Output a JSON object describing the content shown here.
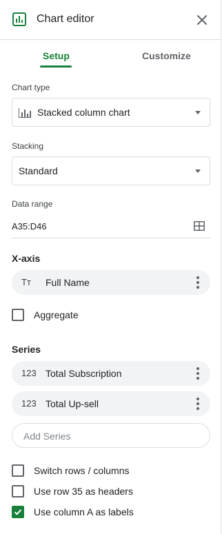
{
  "header": {
    "title": "Chart editor",
    "app_icon": "chart-icon",
    "close_icon": "close-icon"
  },
  "tabs": [
    {
      "label": "Setup",
      "active": true
    },
    {
      "label": "Customize",
      "active": false
    }
  ],
  "chart_type": {
    "label": "Chart type",
    "value": "Stacked column chart",
    "icon": "stacked-column-chart-icon"
  },
  "stacking": {
    "label": "Stacking",
    "value": "Standard"
  },
  "data_range": {
    "label": "Data range",
    "value": "A35:D46",
    "icon": "select-range-grid-icon"
  },
  "x_axis": {
    "title": "X-axis",
    "item": {
      "type_icon": "Tт",
      "label": "Full Name"
    },
    "aggregate": {
      "label": "Aggregate",
      "checked": false
    }
  },
  "series": {
    "title": "Series",
    "items": [
      {
        "type_icon": "123",
        "label": "Total Subscription"
      },
      {
        "type_icon": "123",
        "label": "Total Up-sell"
      }
    ],
    "add_placeholder": "Add Series"
  },
  "options": [
    {
      "label": "Switch rows / columns",
      "checked": false
    },
    {
      "label": "Use row 35 as headers",
      "checked": false
    },
    {
      "label": "Use column A as labels",
      "checked": true
    }
  ],
  "colors": {
    "accent": "#188038",
    "border": "#dadce0",
    "chip_bg": "#f1f3f4"
  }
}
